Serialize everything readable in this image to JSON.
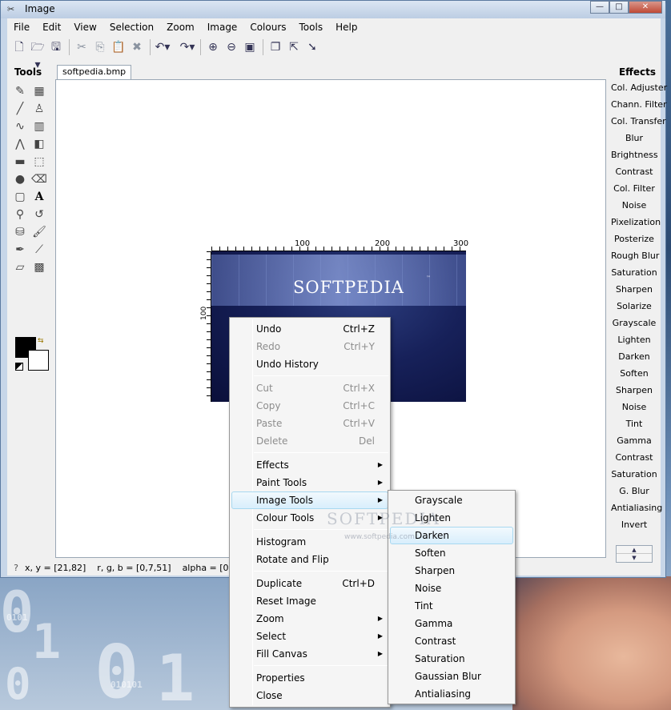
{
  "window": {
    "title": "Image",
    "min": "—",
    "max": "□",
    "close": "✕"
  },
  "menubar": [
    "File",
    "Edit",
    "View",
    "Selection",
    "Zoom",
    "Image",
    "Colours",
    "Tools",
    "Help"
  ],
  "tools_panel": {
    "title": "Tools"
  },
  "tab": {
    "label": "softpedia.bmp"
  },
  "image": {
    "logo": "SOFTPEDIA",
    "tm": "™",
    "ruler_top": [
      "100",
      "200",
      "300"
    ],
    "ruler_left": "100"
  },
  "effects_panel": {
    "title": "Effects",
    "items": [
      "Col. Adjuster",
      "Chann. Filter",
      "Col. Transfer",
      "Blur",
      "Brightness",
      "Contrast",
      "Col. Filter",
      "Noise",
      "Pixelization",
      "Posterize",
      "Rough Blur",
      "Saturation",
      "Sharpen",
      "Solarize",
      "Grayscale",
      "Lighten",
      "Darken",
      "Soften",
      "Sharpen",
      "Noise",
      "Tint",
      "Gamma",
      "Contrast",
      "Saturation",
      "G. Blur",
      "Antialiasing",
      "Invert"
    ]
  },
  "status": {
    "coords": "x, y = [21,82]",
    "rgb": "r, g, b = [0,7,51]",
    "alpha": "alpha = [0]"
  },
  "context_menu": [
    {
      "label": "Undo",
      "shortcut": "Ctrl+Z",
      "enabled": true
    },
    {
      "label": "Redo",
      "shortcut": "Ctrl+Y",
      "enabled": false
    },
    {
      "label": "Undo History",
      "shortcut": "",
      "enabled": true
    },
    {
      "label": "Cut",
      "shortcut": "Ctrl+X",
      "enabled": false
    },
    {
      "label": "Copy",
      "shortcut": "Ctrl+C",
      "enabled": false
    },
    {
      "label": "Paste",
      "shortcut": "Ctrl+V",
      "enabled": false
    },
    {
      "label": "Delete",
      "shortcut": "Del",
      "enabled": false
    },
    {
      "label": "Effects",
      "submenu": true
    },
    {
      "label": "Paint Tools",
      "submenu": true
    },
    {
      "label": "Image Tools",
      "submenu": true,
      "highlighted": true
    },
    {
      "label": "Colour Tools",
      "submenu": true
    },
    {
      "label": "Histogram"
    },
    {
      "label": "Rotate and Flip"
    },
    {
      "label": "Duplicate",
      "shortcut": "Ctrl+D"
    },
    {
      "label": "Reset Image"
    },
    {
      "label": "Zoom",
      "submenu": true
    },
    {
      "label": "Select",
      "submenu": true
    },
    {
      "label": "Fill Canvas",
      "submenu": true
    },
    {
      "label": "Properties"
    },
    {
      "label": "Close"
    }
  ],
  "image_tools_submenu": {
    "highlighted": "Darken",
    "items": [
      "Grayscale",
      "Lighten",
      "Darken",
      "Soften",
      "Sharpen",
      "Noise",
      "Tint",
      "Gamma",
      "Contrast",
      "Saturation",
      "Gaussian Blur",
      "Antialiasing"
    ]
  },
  "watermark": {
    "text": "SOFTPEDIA",
    "url": "www.softpedia.com"
  },
  "desktop": {
    "digits": [
      "0",
      "1",
      "0",
      "1",
      "0",
      "010101",
      "0101"
    ]
  }
}
